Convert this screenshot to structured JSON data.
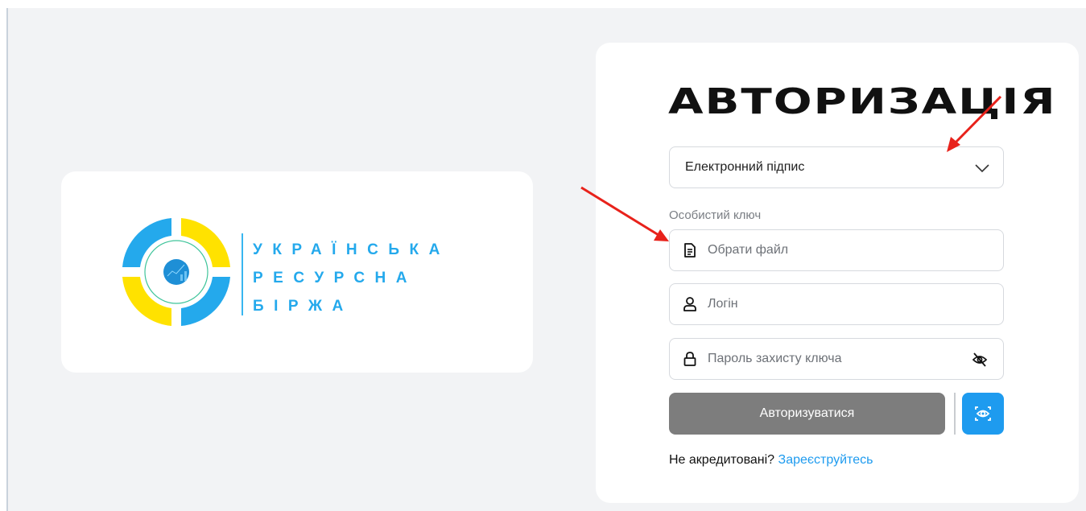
{
  "logo": {
    "lines": [
      "УКРАЇНСЬКА",
      "РЕСУРСНА",
      "БІРЖА"
    ]
  },
  "auth": {
    "title": "АВТОРИЗАЦІЯ",
    "method_select": {
      "value": "Електронний підпис"
    },
    "private_key": {
      "label": "Особистий ключ",
      "placeholder": "Обрати файл"
    },
    "login": {
      "placeholder": "Логін"
    },
    "password": {
      "placeholder": "Пароль захисту ключа"
    },
    "submit_label": "Авторизуватися",
    "register": {
      "prompt": "Не акредитовані?",
      "link_label": "Зареєструйтесь"
    }
  },
  "icons": {
    "select": "chevron-down-icon",
    "file": "document-icon",
    "login": "user-icon",
    "password": "lock-icon",
    "password_toggle": "eye-off-icon",
    "alt_auth": "eye-scan-icon"
  },
  "colors": {
    "brand_blue": "#24a9ec",
    "brand_yellow": "#ffe200",
    "accent_button": "#1e9bef",
    "disabled_button": "#7d7d7d",
    "annotation_arrow": "#e8221b"
  }
}
